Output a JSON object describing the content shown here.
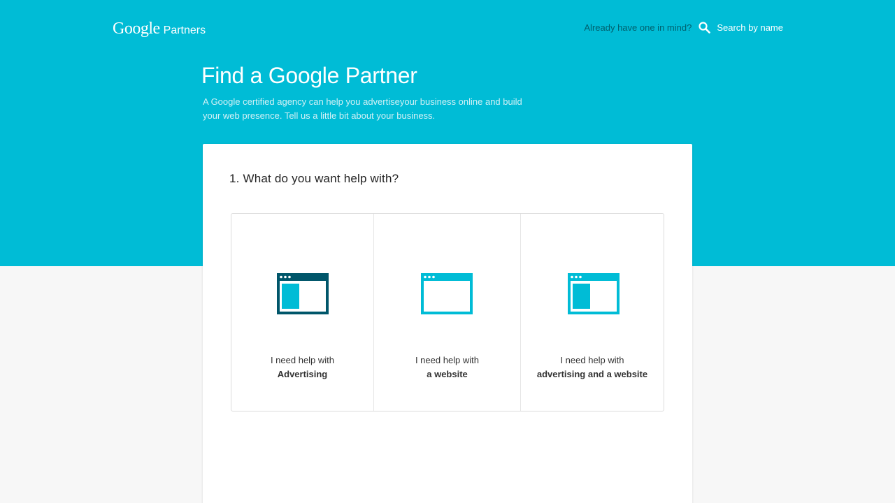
{
  "header": {
    "logo_google": "Google",
    "logo_partners": "Partners",
    "mind_text": "Already have one in mind?",
    "search_label": "Search by name"
  },
  "hero": {
    "title": "Find a Google Partner",
    "description": "A Google certified agency can help you advertiseyour business online and build your web presence. Tell us a little bit about your business."
  },
  "question": {
    "label": "1. What do you want help with?"
  },
  "options": [
    {
      "line1": "I need help with",
      "line2": "Advertising",
      "icon": "browser-window-sidebar-icon"
    },
    {
      "line1": "I need help with",
      "line2": "a website",
      "icon": "browser-window-icon"
    },
    {
      "line1": "I need help with",
      "line2": "advertising and a website",
      "icon": "browser-window-sidebar-icon"
    }
  ],
  "colors": {
    "brand": "#00bcd6",
    "dark_teal": "#00606e",
    "background": "#f7f7f7"
  }
}
